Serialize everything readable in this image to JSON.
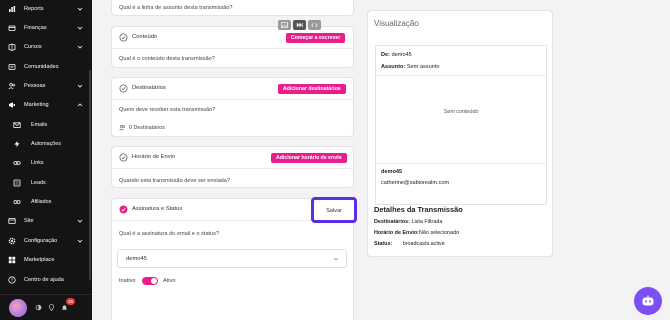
{
  "sidebar": {
    "items": [
      {
        "label": "Reports",
        "icon": "reports-icon",
        "chevron": true
      },
      {
        "label": "Finanças",
        "icon": "finance-icon",
        "chevron": true
      },
      {
        "label": "Cursos",
        "icon": "courses-icon",
        "chevron": true
      },
      {
        "label": "Comunidades",
        "icon": "communities-icon",
        "chevron": false
      },
      {
        "label": "Pessoas",
        "icon": "people-icon",
        "chevron": true
      },
      {
        "label": "Marketing",
        "icon": "marketing-icon",
        "chevron": true
      },
      {
        "label": "Emails",
        "icon": "email-icon",
        "sub": true
      },
      {
        "label": "Automações",
        "icon": "automation-icon",
        "sub": true
      },
      {
        "label": "Links",
        "icon": "link-icon",
        "sub": true
      },
      {
        "label": "Leads",
        "icon": "leads-icon",
        "sub": true
      },
      {
        "label": "Afiliados",
        "icon": "affiliates-icon",
        "sub": true
      },
      {
        "label": "Site",
        "icon": "site-icon",
        "chevron": true
      },
      {
        "label": "Configuração",
        "icon": "settings-icon",
        "chevron": true
      },
      {
        "label": "Marketplace",
        "icon": "marketplace-icon",
        "chevron": false
      },
      {
        "label": "Centro de ajuda",
        "icon": "help-icon",
        "chevron": false
      }
    ],
    "notification_count": "36"
  },
  "top_question": "Qual é a linha de assunto desta transmissão?",
  "content": {
    "title": "Conteúdo",
    "button": "Começar a escrever",
    "question": "Qual é o conteúdo desta transmissão?"
  },
  "recipients": {
    "title": "Destinatários",
    "button": "Adicionar destinatários",
    "question": "Quem deve receber esta transmissão?",
    "count_label": "0 Destinatários"
  },
  "schedule": {
    "title": "Horário de Envio",
    "button": "Adicionar horário de envio",
    "question": "Quando esta transmissão deve ser enviada?"
  },
  "signature": {
    "title": "Assinatura e Status",
    "save_label": "Salvar",
    "question": "Qual é a assinatura do email e o status?",
    "select_value": "demo45",
    "inactive_label": "Inativo",
    "active_label": "Ativo",
    "active": true
  },
  "preview": {
    "title": "Visualização",
    "from_key": "De:",
    "from_value": "demo45",
    "subject_key": "Assunto:",
    "subject_value": "Sem assunto",
    "empty_text": "Sem conteúdo",
    "signature_name": "demo45",
    "signature_email": "catherine@sabiorealm.com"
  },
  "details": {
    "title": "Detalhes da Transmissão",
    "recipients_key": "Destinatários:",
    "recipients_value": "Lista Filtrada",
    "schedule_key": "Horário de Envio:",
    "schedule_value": "Não selecionado",
    "status_key": "Status:",
    "status_value": "broadcasts.active"
  },
  "colors": {
    "accent": "#e91e8c",
    "highlight": "#5a2ee8",
    "fab": "#7b4ff2"
  }
}
